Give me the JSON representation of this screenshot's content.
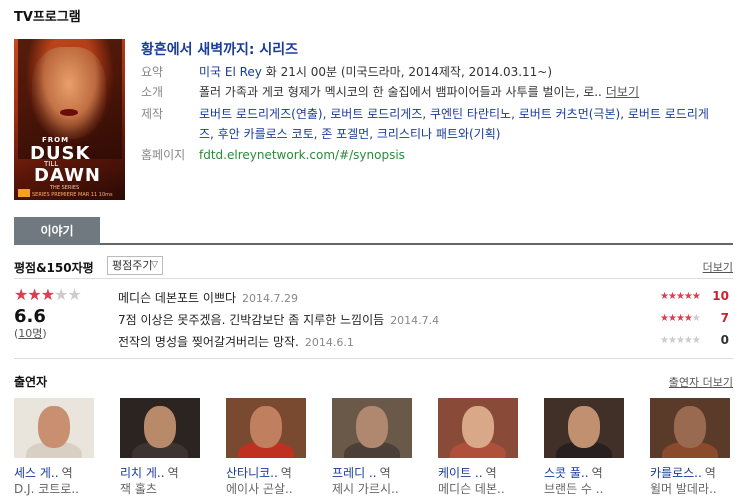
{
  "section_title": "TV프로그램",
  "program": {
    "title": "황혼에서 새벽까지: 시리즈",
    "poster": {
      "from": "FROM",
      "dusk": "DUSK",
      "till": "TILL",
      "dawn": "DAWN",
      "series": "THE SERIES",
      "premiere": "SERIES PREMIERE MAR 11 10ms"
    },
    "summary_label": "요약",
    "summary_channel": "미국 El Rey",
    "summary_rest": " 화 21시 00분 (미국드라마, 2014제작, 2014.03.11~)",
    "intro_label": "소개",
    "intro_text": "폴러 가족과 게코 형제가 멕시코의 한 술집에서 뱀파이어들과 사투를 벌이는, 로..",
    "intro_more": "더보기",
    "prod_label": "제작",
    "prod_line1": "로버트 로드리게즈(연출), 로버트 로드리게즈, 쿠엔틴 타란티노, 로버트 커츠먼(극본), 로버트 로드리게",
    "prod_line2": "즈, 후안 카를로스 코토, 존 포겔먼, 크리스티나 패트와(기획)",
    "homepage_label": "홈페이지",
    "homepage_url": "fdtd.elreynetwork.com/#/synopsis"
  },
  "tabs": [
    {
      "label": "이야기"
    }
  ],
  "ratings": {
    "heading": "평점&150자평",
    "rate_button": "평점주기",
    "more": "더보기",
    "average": "6.6",
    "count": "10명",
    "average_stars": 3.3,
    "reviews": [
      {
        "text": "메디슨 데본포트 이쁘다",
        "date": "2014.7.29",
        "score": "10",
        "stars": 5
      },
      {
        "text": "7점 이상은 못주겠음. 긴박감보단 좀 지루한 느낌이듬",
        "date": "2014.7.4",
        "score": "7",
        "stars": 3.5
      },
      {
        "text": "전작의 명성을 찢어갈겨버리는 망작.",
        "date": "2014.6.1",
        "score": "0",
        "stars": 0
      }
    ]
  },
  "cast": {
    "heading": "출연자",
    "more": "출연자 더보기",
    "role_suffix": "역",
    "members": [
      {
        "name": "세스 게..",
        "role": "D.J. 코트로..",
        "skin": "#c89070",
        "bg": "#e9e4dc",
        "cloth": "#d8d0c4"
      },
      {
        "name": "리치 게..",
        "role": "잭 홀츠",
        "skin": "#b88a6a",
        "bg": "#2c2420",
        "cloth": "#3c3430"
      },
      {
        "name": "산타니코..",
        "role": "에이사 곤살..",
        "skin": "#c08060",
        "bg": "#7a4a30",
        "cloth": "#c03020"
      },
      {
        "name": "프레디 ..",
        "role": "제시 가르시..",
        "skin": "#b08870",
        "bg": "#6a5848",
        "cloth": "#4a4038"
      },
      {
        "name": "케이트 ..",
        "role": "메디슨 데본..",
        "skin": "#d8a888",
        "bg": "#8a4a38",
        "cloth": "#b0503c"
      },
      {
        "name": "스콧 풀..",
        "role": "브랜든 수 ..",
        "skin": "#c09070",
        "bg": "#403028",
        "cloth": "#282020"
      },
      {
        "name": "카를로스..",
        "role": "윌머 발데라..",
        "skin": "#9a6a50",
        "bg": "#5a3a28",
        "cloth": "#8a4a2c"
      }
    ]
  }
}
